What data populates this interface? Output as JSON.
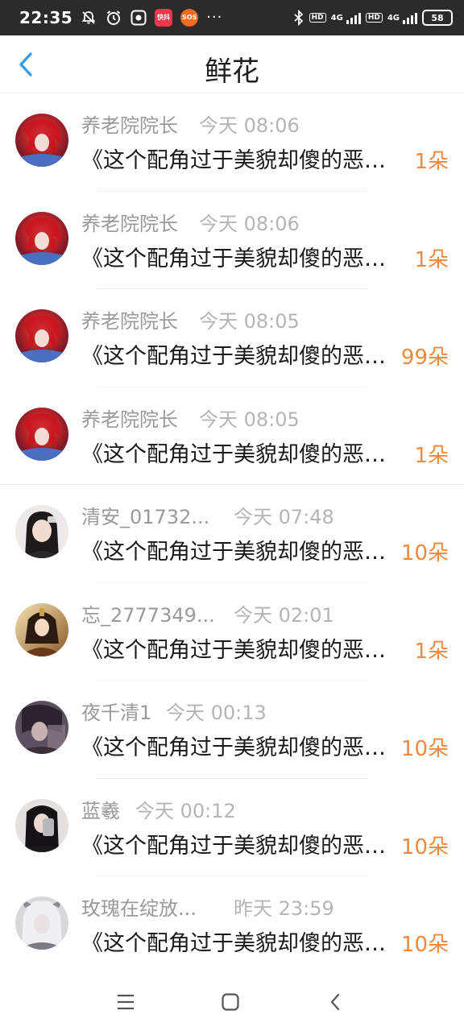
{
  "status_bar": {
    "time": "22:35",
    "app_badge_1": "快抖",
    "app_badge_2": "SOS",
    "more": "···",
    "hd1": "HD",
    "net1": "4G",
    "hd2": "HD",
    "net2": "4G",
    "battery": "58"
  },
  "header": {
    "title": "鲜花"
  },
  "items": [
    {
      "name": "养老院院长",
      "time": "今天 08:06",
      "message": "《这个配角过于美貌却傻的恶毒女配》",
      "count": "1朵",
      "avatar": "red-hair-anime"
    },
    {
      "name": "养老院院长",
      "time": "今天 08:06",
      "message": "《这个配角过于美貌却傻的恶毒女配》",
      "count": "1朵",
      "avatar": "red-hair-anime"
    },
    {
      "name": "养老院院长",
      "time": "今天 08:05",
      "message": "《这个配角过于美貌却傻的恶毒女配》",
      "count": "99朵",
      "avatar": "red-hair-anime"
    },
    {
      "name": "养老院院长",
      "time": "今天 08:05",
      "message": "《这个配角过于美貌却傻的恶毒女配》",
      "count": "1朵",
      "avatar": "red-hair-anime"
    },
    {
      "name": "清安_01732...",
      "time": "今天 07:48",
      "message": "《这个配角过于美貌却傻的恶毒女配》",
      "count": "10朵",
      "avatar": "girl-photo"
    },
    {
      "name": "忘_2777349...",
      "time": "今天 02:01",
      "message": "《这个配角过于美貌却傻的恶毒女配》",
      "count": "1朵",
      "avatar": "ancient-costume"
    },
    {
      "name": "夜千清1",
      "time": "今天 00:13",
      "message": "《这个配角过于美貌却傻的恶毒女配》",
      "count": "10朵",
      "avatar": "dark-photo"
    },
    {
      "name": "蓝羲",
      "time": "今天 00:12",
      "message": "《这个配角过于美貌却傻的恶毒女配》",
      "count": "10朵",
      "avatar": "mirror-selfie"
    },
    {
      "name": "玫瑰在绽放...",
      "time": "昨天 23:59",
      "message": "《这个配角过于美貌却傻的恶毒女配》",
      "count": "10朵",
      "avatar": "white-hair-anime"
    }
  ],
  "colors": {
    "accent": "#2f9ee8",
    "count": "#f0883e",
    "name": "#9a9a9a",
    "time": "#b5b5b5"
  }
}
